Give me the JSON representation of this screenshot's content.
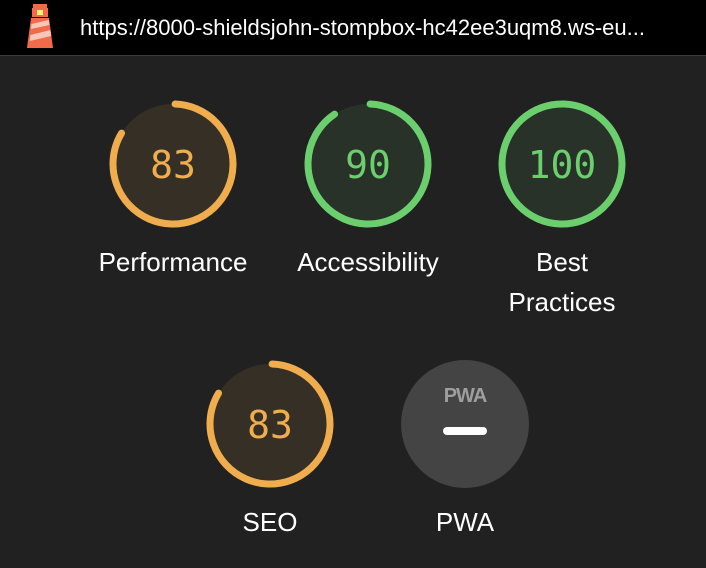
{
  "header": {
    "url": "https://8000-shieldsjohn-stompbox-hc42ee3uqm8.ws-eu..."
  },
  "colors": {
    "average": "#f0ad4e",
    "pass": "#6ccf6e",
    "pwa_gray": "#444444",
    "background": "#212121"
  },
  "categories": [
    {
      "id": "performance",
      "score": "83",
      "label": "Performance",
      "rating": "average"
    },
    {
      "id": "accessibility",
      "score": "90",
      "label": "Accessibility",
      "rating": "pass"
    },
    {
      "id": "best-practices",
      "score": "100",
      "label_line1": "Best",
      "label_line2": "Practices",
      "rating": "pass"
    },
    {
      "id": "seo",
      "score": "83",
      "label": "SEO",
      "rating": "average"
    },
    {
      "id": "pwa",
      "badge": "PWA",
      "label": "PWA",
      "rating": "not-applicable"
    }
  ]
}
